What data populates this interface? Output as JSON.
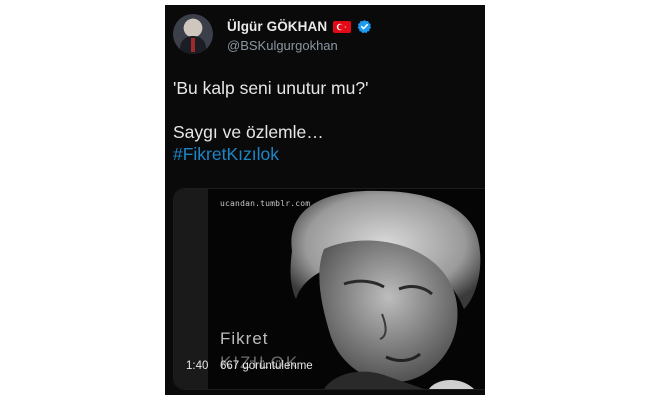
{
  "author": {
    "display_name": "Ülgür GÖKHAN",
    "handle": "@BSKulgurgokhan",
    "flag_icon": "turkey-flag-icon",
    "verified_icon": "verified-badge-icon",
    "verified_color": "#1d9bf0"
  },
  "tweet": {
    "line1": "'Bu kalp seni unutur mu?'",
    "line2": "Saygı ve özlemle…",
    "hashtag": "#FikretKızılok",
    "hashtag_color": "#1d86c8"
  },
  "media": {
    "watermark": "ucandan.tumblr.com",
    "title": "Fikret",
    "title_cut": "KIZILOK",
    "duration": "1:40",
    "views": "667 görüntülenme"
  }
}
